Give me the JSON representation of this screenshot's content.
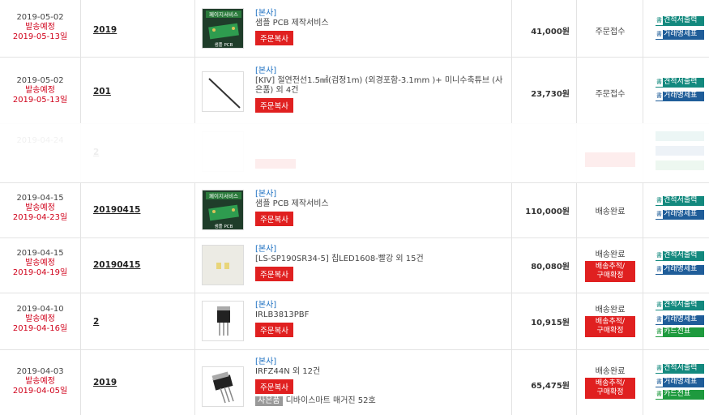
{
  "common": {
    "tag": "[본사]",
    "copy_label": "주문복사",
    "track_label_1": "배송추적/",
    "track_label_2": "구매확정",
    "doc_estimate": "견적서출력",
    "doc_transaction": "거래명세표",
    "doc_card": "카드전표",
    "doc_icon": "書",
    "pcb_logo": "페이지서비스",
    "pcb_thumb_caption": "샘플 PCB"
  },
  "orders": [
    {
      "date": "2019-05-02",
      "ship_label": "발송예정",
      "ship_date": "2019-05-13일",
      "order_no": "2019",
      "item": "샘플 PCB 제작서비스",
      "price": "41,000원",
      "status": "주문접수"
    },
    {
      "date": "2019-05-02",
      "ship_label": "발송예정",
      "ship_date": "2019-05-13일",
      "order_no": "201",
      "item": "[KIV] 절연전선1.5㎟(검정1m) (외경포함-3.1mm )+ 미니수축튜브 (사은품) 외 4건",
      "price": "23,730원",
      "status": "주문접수"
    },
    {
      "date": "2019-04-24",
      "ship_label": "",
      "ship_date": "",
      "order_no": "2",
      "item": "",
      "price": "",
      "status": ""
    },
    {
      "date": "2019-04-15",
      "ship_label": "발송예정",
      "ship_date": "2019-04-23일",
      "order_no": "20190415",
      "item": "샘플 PCB 제작서비스",
      "price": "110,000원",
      "status": "배송완료"
    },
    {
      "date": "2019-04-15",
      "ship_label": "발송예정",
      "ship_date": "2019-04-19일",
      "order_no": "20190415",
      "item": "[LS-SP190SR34-5] 칩LED1608-빨강 외 15건",
      "price": "80,080원",
      "status": "배송완료"
    },
    {
      "date": "2019-04-10",
      "ship_label": "발송예정",
      "ship_date": "2019-04-16일",
      "order_no": "2",
      "item": "IRLB3813PBF",
      "price": "10,915원",
      "status": "배송완료"
    },
    {
      "date": "2019-04-03",
      "ship_label": "발송예정",
      "ship_date": "2019-04-05일",
      "order_no": "2019",
      "item": "IRFZ44N 외 12건",
      "price": "65,475원",
      "status": "배송완료",
      "gift_tag": "사은품",
      "gift_text": "디바이스마트 매거진 52호"
    }
  ]
}
